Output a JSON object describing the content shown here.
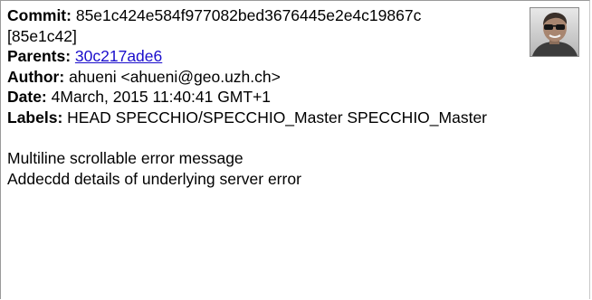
{
  "commit": {
    "commit_label": "Commit:",
    "commit_hash": "85e1c424e584f977082bed3676445e2e4c19867c",
    "short_hash": "[85e1c42]",
    "parents_label": "Parents:",
    "parent_hash": "30c217ade6",
    "author_label": "Author:",
    "author_value": "ahueni <ahueni@geo.uzh.ch>",
    "date_label": "Date:",
    "date_value": "4March, 2015 11:40:41 GMT+1",
    "labels_label": "Labels:",
    "labels_value": "HEAD SPECCHIO/SPECCHIO_Master SPECCHIO_Master"
  },
  "message": {
    "line1": "Multiline scrollable error message",
    "line2": "Addecdd details of underlying server error"
  },
  "colors": {
    "link": "#1a0dcc",
    "border": "#9a9a9a"
  },
  "icons": {
    "avatar": "author-avatar-photo"
  }
}
